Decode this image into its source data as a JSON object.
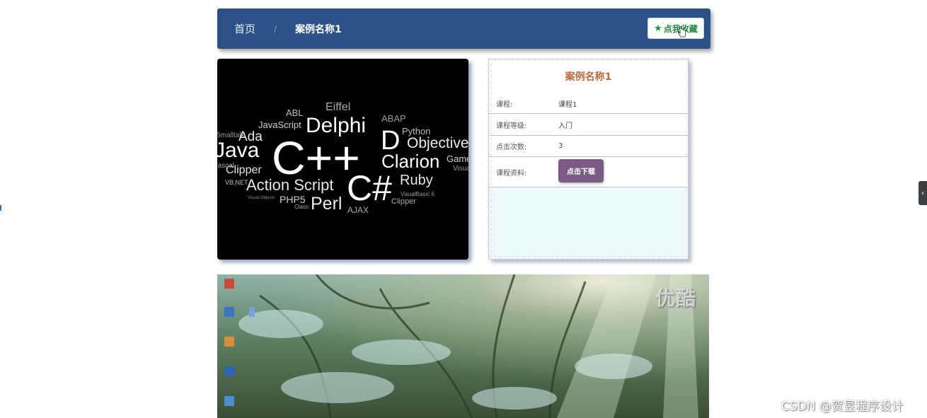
{
  "breadcrumb": {
    "home": "首页",
    "separator": "/",
    "current": "案例名称1"
  },
  "favorite_button": {
    "icon": "star-icon",
    "label": "点我收藏"
  },
  "cover_words": [
    "ABL",
    "Eiffel",
    "ABAP",
    "JavaScript",
    "Delphi",
    "Python",
    "Smalltalk",
    "Ada",
    "D",
    "Objective",
    "Java",
    "C++",
    "Clarion",
    "Game",
    "Clipper",
    "C#",
    "Visual",
    "Ruby",
    "VB.NET",
    "Action Script",
    "VisualBasic 6",
    "Visual Objects",
    "PHP5",
    "Perl",
    "Clipper",
    "Class",
    "AJAX",
    "Pascal"
  ],
  "info_panel": {
    "title": "案例名称1",
    "rows": [
      {
        "label": "课程:",
        "value": "课程1"
      },
      {
        "label": "课程等级:",
        "value": "入门"
      },
      {
        "label": "点击次数:",
        "value": "3"
      }
    ],
    "download": {
      "label": "课程资料:",
      "button": "点击下载"
    }
  },
  "video": {
    "logo": "优酷"
  },
  "side_tab": {
    "icon": "chevron-left-icon",
    "glyph": "‹"
  },
  "watermark": "CSDN @贺昱程序设计",
  "colors": {
    "header_bg": "#2c5187",
    "favorite_text": "#1f8a3e",
    "title_text": "#b9693c",
    "download_bg": "#7b5b86",
    "panel_bg": "#f0fbfe"
  }
}
